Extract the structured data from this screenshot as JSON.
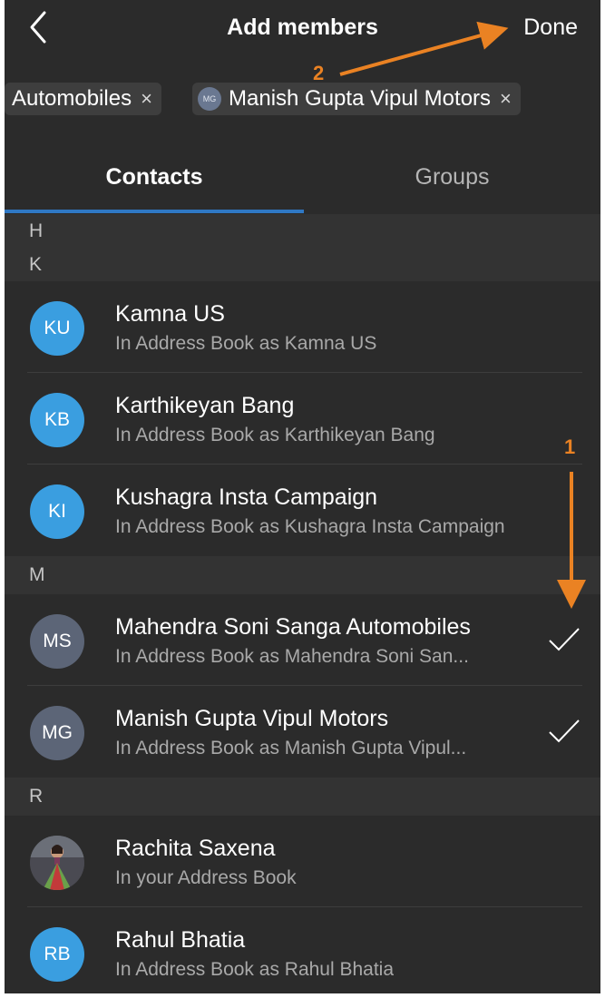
{
  "header": {
    "title": "Add members",
    "done_label": "Done"
  },
  "selected_chips": [
    {
      "label": "Automobiles",
      "remove": "×"
    },
    {
      "label": "Manish Gupta Vipul Motors",
      "initials": "MG",
      "remove": "×"
    }
  ],
  "tabs": [
    {
      "label": "Contacts",
      "active": true
    },
    {
      "label": "Groups",
      "active": false
    }
  ],
  "sections": {
    "h": "H",
    "k": "K",
    "m": "M",
    "r": "R"
  },
  "contacts": [
    {
      "initials": "KU",
      "name": "Kamna US",
      "sub": "In Address Book as Kamna US",
      "avatar": "blue",
      "selected": false
    },
    {
      "initials": "KB",
      "name": "Karthikeyan Bang",
      "sub": "In Address Book as Karthikeyan Bang",
      "avatar": "blue",
      "selected": false
    },
    {
      "initials": "KI",
      "name": "Kushagra Insta Campaign",
      "sub": "In Address Book as Kushagra Insta Campaign",
      "avatar": "blue",
      "selected": false
    },
    {
      "initials": "MS",
      "name": "Mahendra Soni Sanga Automobiles",
      "sub": "In Address Book as Mahendra Soni San...",
      "avatar": "gray",
      "selected": true
    },
    {
      "initials": "MG",
      "name": "Manish Gupta Vipul Motors",
      "sub": "In Address Book as Manish Gupta Vipul...",
      "avatar": "gray",
      "selected": true
    },
    {
      "initials": "",
      "name": "Rachita Saxena",
      "sub": "In your Address Book",
      "avatar": "photo",
      "selected": false
    },
    {
      "initials": "RB",
      "name": "Rahul Bhatia",
      "sub": "In Address Book as Rahul Bhatia",
      "avatar": "blue",
      "selected": false
    }
  ],
  "annotations": {
    "step1": "1",
    "step2": "2",
    "color": "#ea8223"
  },
  "colors": {
    "background": "#2b2b2b",
    "section": "#333333",
    "accent": "#2f78c4",
    "avatar_blue": "#3a9ee0",
    "avatar_gray": "#5c6577"
  }
}
